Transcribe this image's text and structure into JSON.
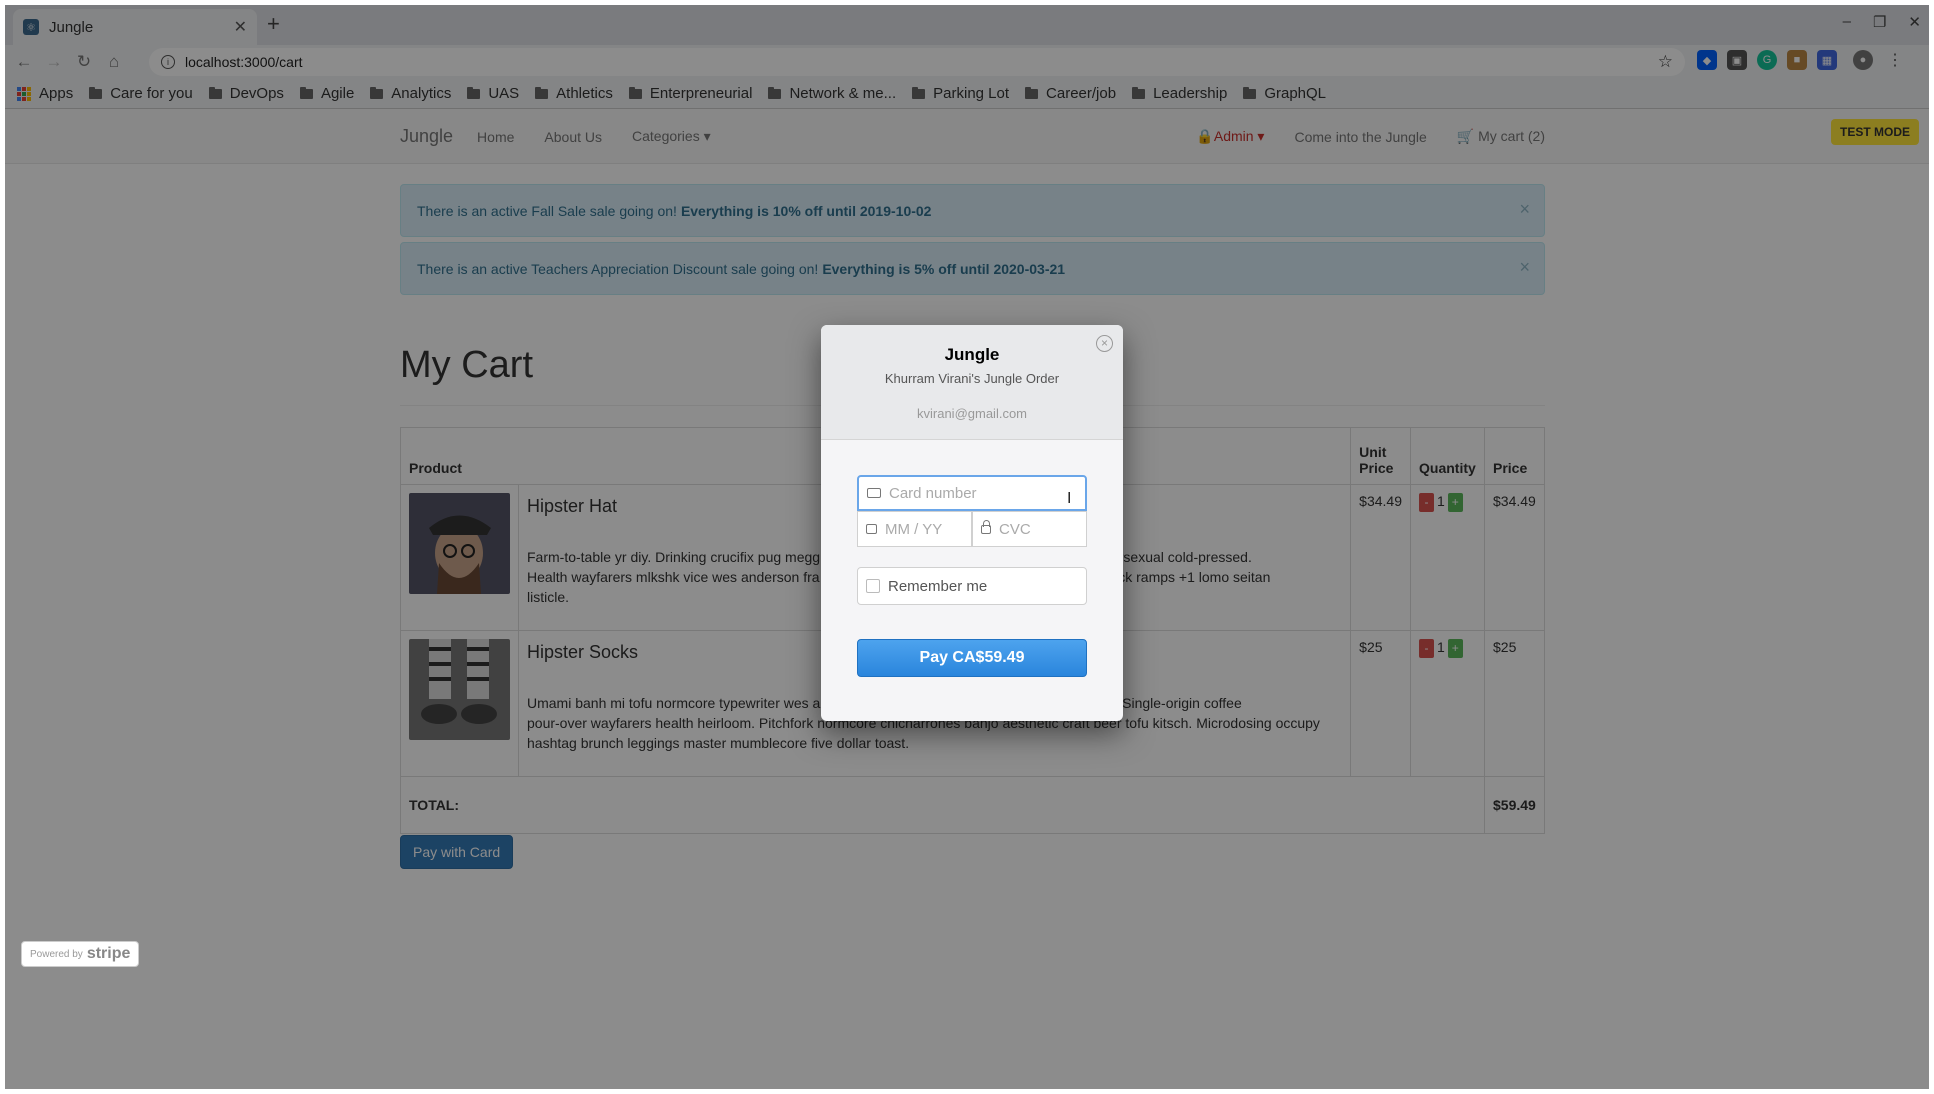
{
  "browser": {
    "tab_title": "Jungle",
    "url": "localhost:3000/cart",
    "bookmarks": [
      "Apps",
      "Care for you",
      "DevOps",
      "Agile",
      "Analytics",
      "UAS",
      "Athletics",
      "Enterpreneurial",
      "Network & me...",
      "Parking Lot",
      "Career/job",
      "Leadership",
      "GraphQL"
    ]
  },
  "navbar": {
    "brand": "Jungle",
    "links": [
      "Home",
      "About Us",
      "Categories"
    ],
    "admin": "Admin",
    "come": "Come into the Jungle",
    "cart": "My cart (2)",
    "test_mode": "TEST MODE"
  },
  "alerts": [
    {
      "text": "There is an active Fall Sale sale going on!",
      "bold": "Everything is 10% off until 2019-10-02"
    },
    {
      "text": "There is an active Teachers Appreciation Discount sale going on!",
      "bold": "Everything is 5% off until 2020-03-21"
    }
  ],
  "cart": {
    "title": "My Cart",
    "headers": {
      "product": "Product",
      "unit_price": "Unit Price",
      "quantity": "Quantity",
      "price": "Price"
    },
    "items": [
      {
        "name": "Hipster Hat",
        "desc": "Farm-to-table yr diy. Drinking crucifix pug megg… leo lumbersexual cold-pressed. Health wayfarers mlkshk vice wes anderson fra… e. Bushwick ramps +1 lomo seitan listicle.",
        "desc_a": "Farm-to-table yr diy. Drinking crucifix pug megg",
        "desc_b": "leo lumbersexual cold-pressed.",
        "desc_c": "Health wayfarers mlkshk vice wes anderson fra",
        "desc_d": "e. Bushwick ramps +1 lomo seitan",
        "desc_e": "listicle.",
        "unit": "$34.49",
        "qty": "1",
        "price": "$34.49"
      },
      {
        "name": "Hipster Socks",
        "desc_a": "Umami banh mi tofu normcore typewriter wes a",
        "desc_b": "ast synth. Single-origin coffee",
        "desc_c": "pour-over wayfarers health heirloom. Pitchfork normcore chicharrones banjo aesthetic craft beer tofu kitsch. Microdosing occupy",
        "desc_d": "hashtag brunch leggings master mumblecore five dollar toast.",
        "unit": "$25",
        "qty": "1",
        "price": "$25"
      }
    ],
    "total_label": "TOTAL:",
    "total": "$59.49",
    "pay_button": "Pay with Card"
  },
  "stripe_modal": {
    "title": "Jungle",
    "subtitle": "Khurram Virani's Jungle Order",
    "email": "kvirani@gmail.com",
    "card_placeholder": "Card number",
    "expiry_placeholder": "MM / YY",
    "cvc_placeholder": "CVC",
    "remember": "Remember me",
    "pay": "Pay CA$59.49"
  },
  "powered_by": {
    "prefix": "Powered by",
    "brand": "stripe"
  }
}
